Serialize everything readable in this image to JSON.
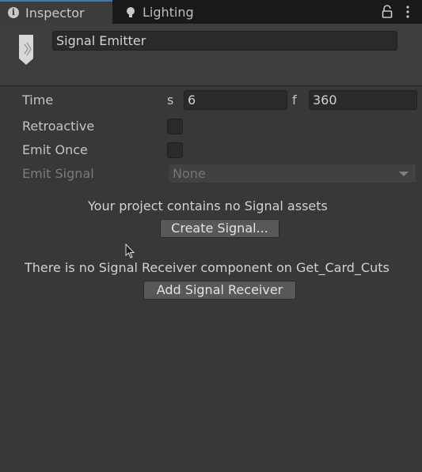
{
  "tabs": [
    {
      "label": "Inspector",
      "icon": "info-icon",
      "active": true
    },
    {
      "label": "Lighting",
      "icon": "lightbulb-icon",
      "active": false
    }
  ],
  "toolbar": {
    "lock_icon": "lock-icon",
    "menu_icon": "kebab-menu-icon"
  },
  "header": {
    "object_icon": "signal-emitter-icon",
    "name_value": "Signal Emitter"
  },
  "properties": {
    "time": {
      "label": "Time",
      "s_label": "s",
      "s_value": "6",
      "f_label": "f",
      "f_value": "360"
    },
    "retroactive": {
      "label": "Retroactive",
      "checked": false
    },
    "emit_once": {
      "label": "Emit Once",
      "checked": false
    },
    "emit_signal": {
      "label": "Emit Signal",
      "value": "None",
      "enabled": false
    }
  },
  "messages": {
    "no_signal_assets": "Your project contains no Signal assets",
    "create_signal_button": "Create Signal...",
    "no_receiver": "There is no Signal Receiver component on Get_Card_Cuts",
    "add_receiver_button": "Add Signal Receiver"
  },
  "colors": {
    "panel_bg": "#383838",
    "tabbar_bg": "#191919",
    "active_tab_accent": "#3a79bb",
    "field_bg": "#2a2a2a",
    "button_bg": "#585858"
  }
}
